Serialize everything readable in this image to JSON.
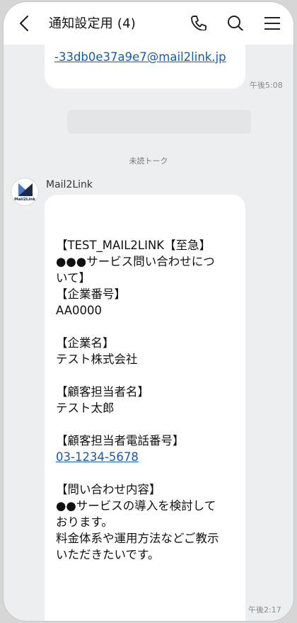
{
  "header": {
    "title": "通知設定用 (4)"
  },
  "icons": {
    "back": "chevron-left-icon",
    "call": "phone-icon",
    "search": "search-icon",
    "menu": "hamburger-menu-icon"
  },
  "messages": [
    {
      "link": "-33db0e37a9e7@mail2link.jp",
      "time": "午後5:08"
    }
  ],
  "divider": {
    "label": "未読トーク"
  },
  "sender": {
    "name": "Mail2Link",
    "avatar_text": "Mail2Link"
  },
  "message_main": {
    "lines": [
      "【TEST_MAIL2LINK【至急】",
      "●●●サービス問い合わせにつ",
      "いて】",
      "【企業番号】",
      "AA0000",
      "",
      "【企業名】",
      "テスト株式会社",
      "",
      "【顧客担当者名】",
      "テスト太郎",
      "",
      "【顧客担当者電話番号】",
      "03-1234-5678",
      "",
      "【問い合わせ内容】",
      "●●サービスの導入を検討して",
      "おります。",
      "料金体系や運用方法などご教示",
      "いただきたいです。"
    ],
    "phone": "03-1234-5678",
    "time": "午後2:17"
  },
  "colors": {
    "background": "#edeef0",
    "bubble": "#ffffff",
    "link": "#1a5aa8"
  }
}
